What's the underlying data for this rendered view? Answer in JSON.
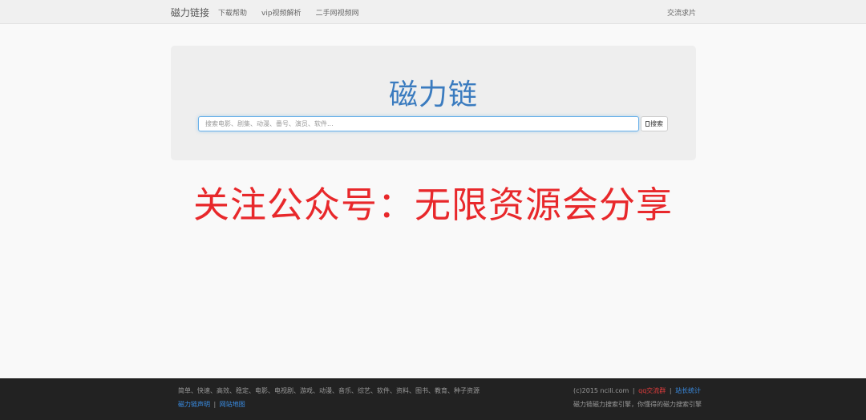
{
  "navbar": {
    "brand": "磁力链接",
    "links": [
      "下载帮助",
      "vip视频解析",
      "二手网视频网"
    ],
    "right_link": "交流求片"
  },
  "hero": {
    "title": "磁力链",
    "search_placeholder": "搜索电影、剧集、动漫、番号、演员、软件...",
    "search_button": "搜索"
  },
  "overlay": {
    "text": "关注公众号：无限资源会分享"
  },
  "footer": {
    "tags": "简单、快速、高效、稳定、电影、电视剧、游戏、动漫、音乐、综艺、软件、资料、图书、教育、种子资源",
    "link_disclaimer": "磁力链声明",
    "link_sitemap": "网站地图",
    "separator": "|",
    "copyright": "(c)2015 ncili.com",
    "qq_group": "qq交流群",
    "stats": "站长统计",
    "slogan": "磁力链磁力搜索引擎，你懂得的磁力搜索引擎"
  },
  "colors": {
    "accent": "#3a7bbf",
    "overlay_red": "#e8282b",
    "footer_bg": "#222222",
    "link_blue": "#3a8ee6"
  }
}
